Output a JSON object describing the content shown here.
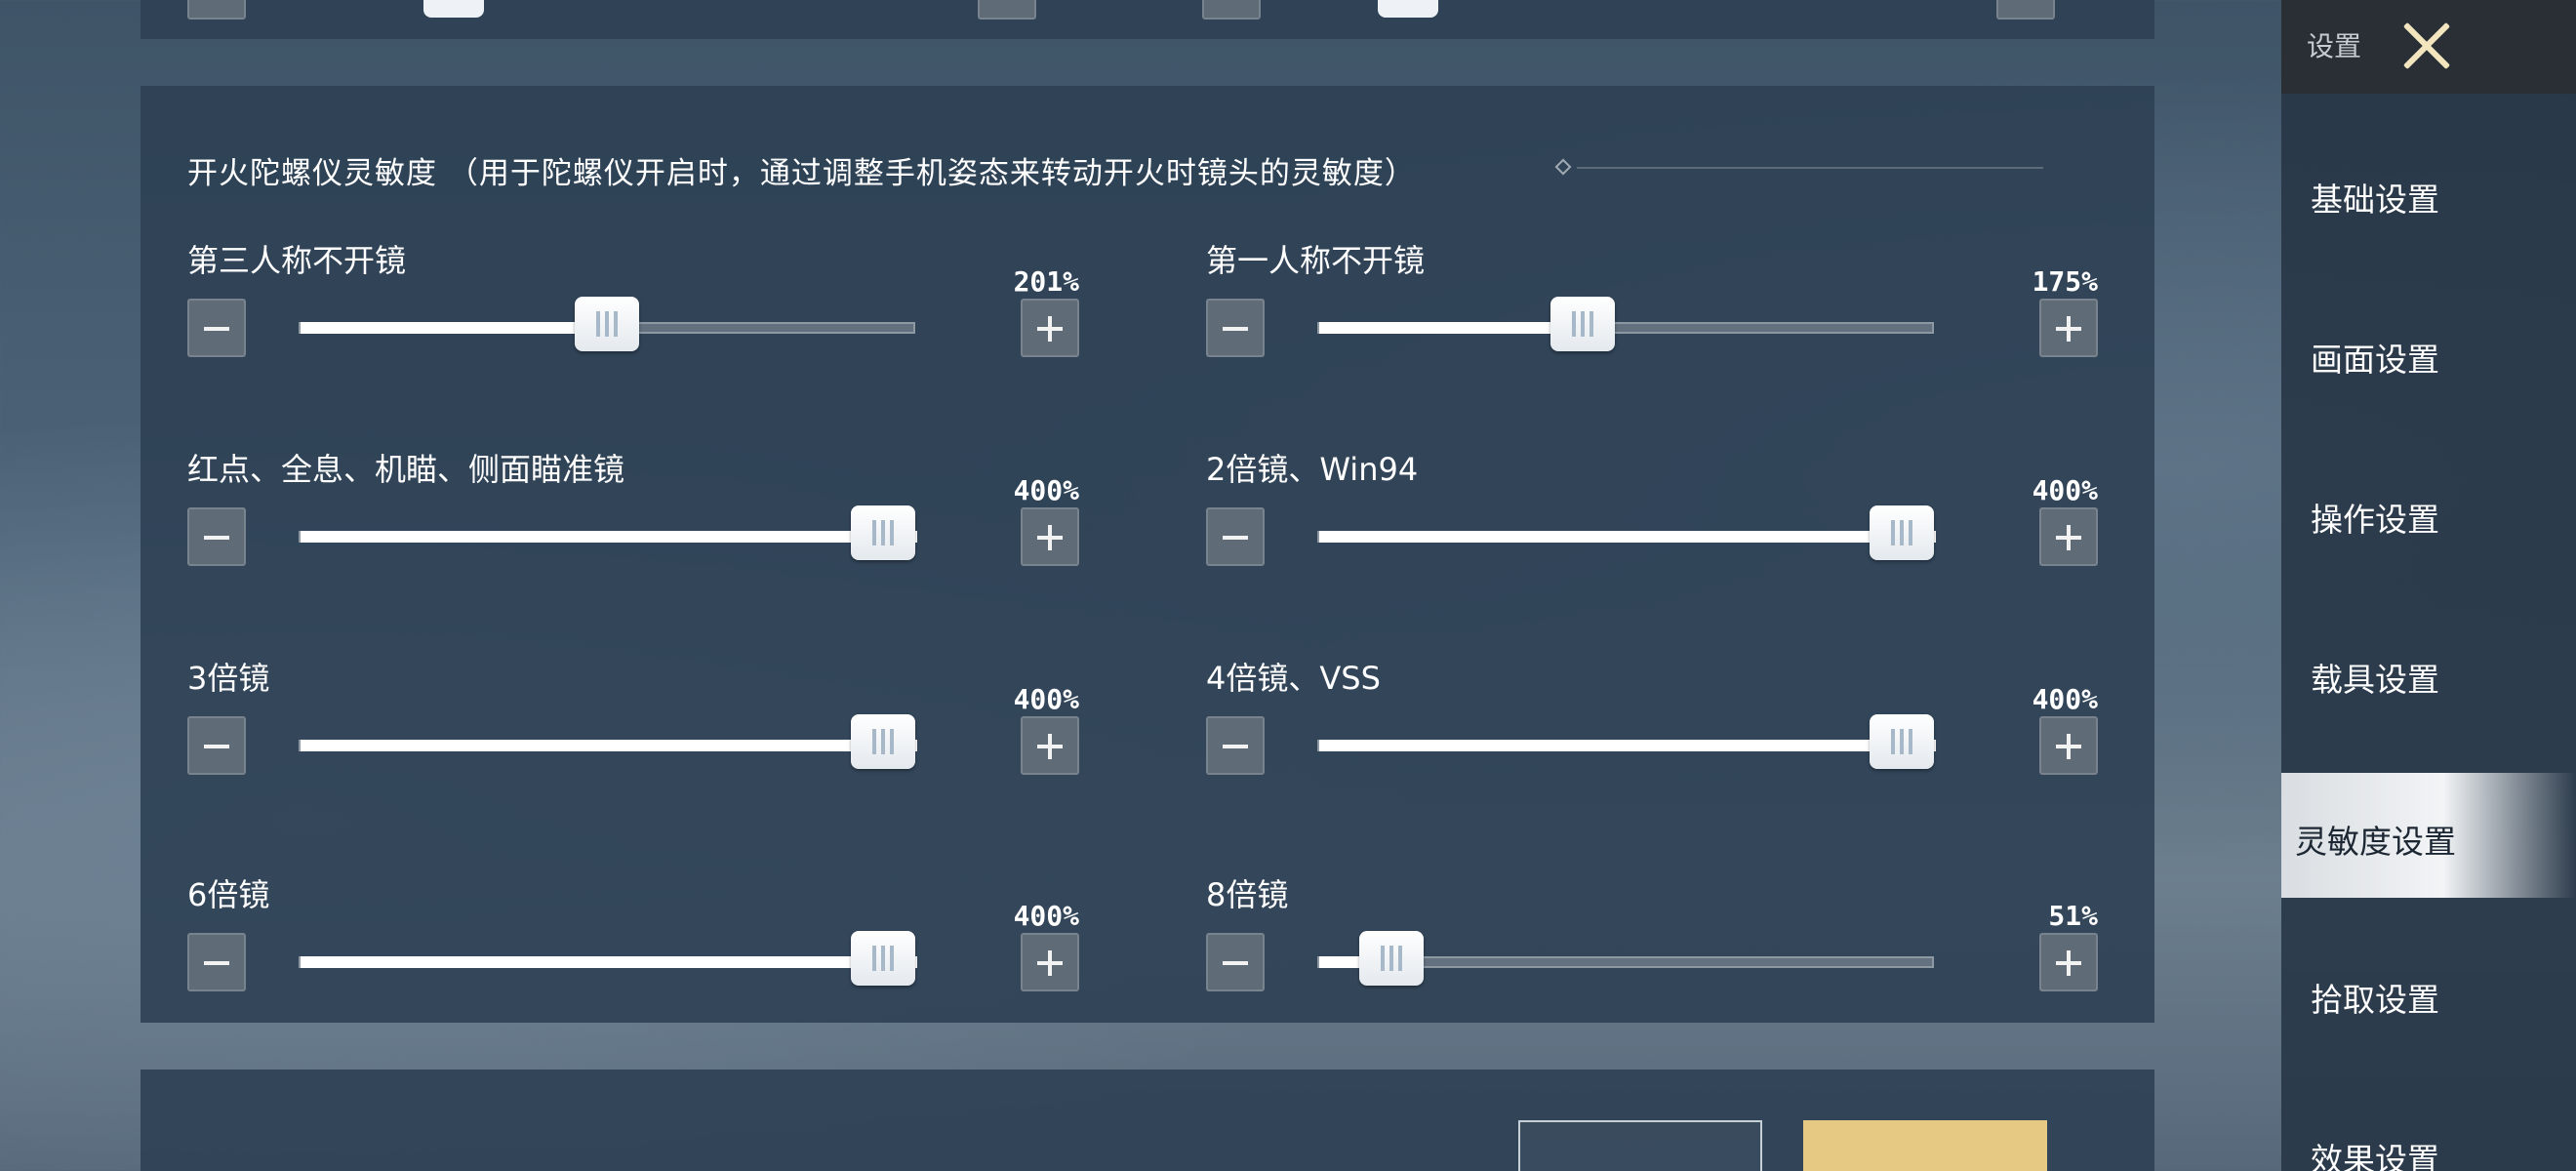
{
  "sidebar": {
    "header_title": "设置",
    "items": [
      {
        "label": "基础设置",
        "active": false
      },
      {
        "label": "画面设置",
        "active": false
      },
      {
        "label": "操作设置",
        "active": false
      },
      {
        "label": "载具设置",
        "active": false
      },
      {
        "label": "灵敏度设置",
        "active": true
      },
      {
        "label": "拾取设置",
        "active": false
      },
      {
        "label": "效果设置",
        "active": false
      }
    ]
  },
  "section": {
    "title": "开火陀螺仪灵敏度 （用于陀螺仪开启时，通过调整手机姿态来转动开火时镜头的灵敏度）",
    "sliders": [
      {
        "label": "第三人称不开镜",
        "value": "201%",
        "fraction": 0.5
      },
      {
        "label": "第一人称不开镜",
        "value": "175%",
        "fraction": 0.43
      },
      {
        "label": "红点、全息、机瞄、侧面瞄准镜",
        "value": "400%",
        "fraction": 1.0
      },
      {
        "label": "2倍镜、Win94",
        "value": "400%",
        "fraction": 1.0
      },
      {
        "label": "3倍镜",
        "value": "400%",
        "fraction": 1.0
      },
      {
        "label": "4倍镜、VSS",
        "value": "400%",
        "fraction": 1.0
      },
      {
        "label": "6倍镜",
        "value": "400%",
        "fraction": 1.0
      },
      {
        "label": "8倍镜",
        "value": "51%",
        "fraction": 0.12
      }
    ]
  },
  "bottom_section": {
    "title": ""
  },
  "colors": {
    "panel": "#2e4054",
    "active_nav": "#f2f4f6",
    "close_icon": "#f3e6bf",
    "gold_button": "#e6c982"
  }
}
